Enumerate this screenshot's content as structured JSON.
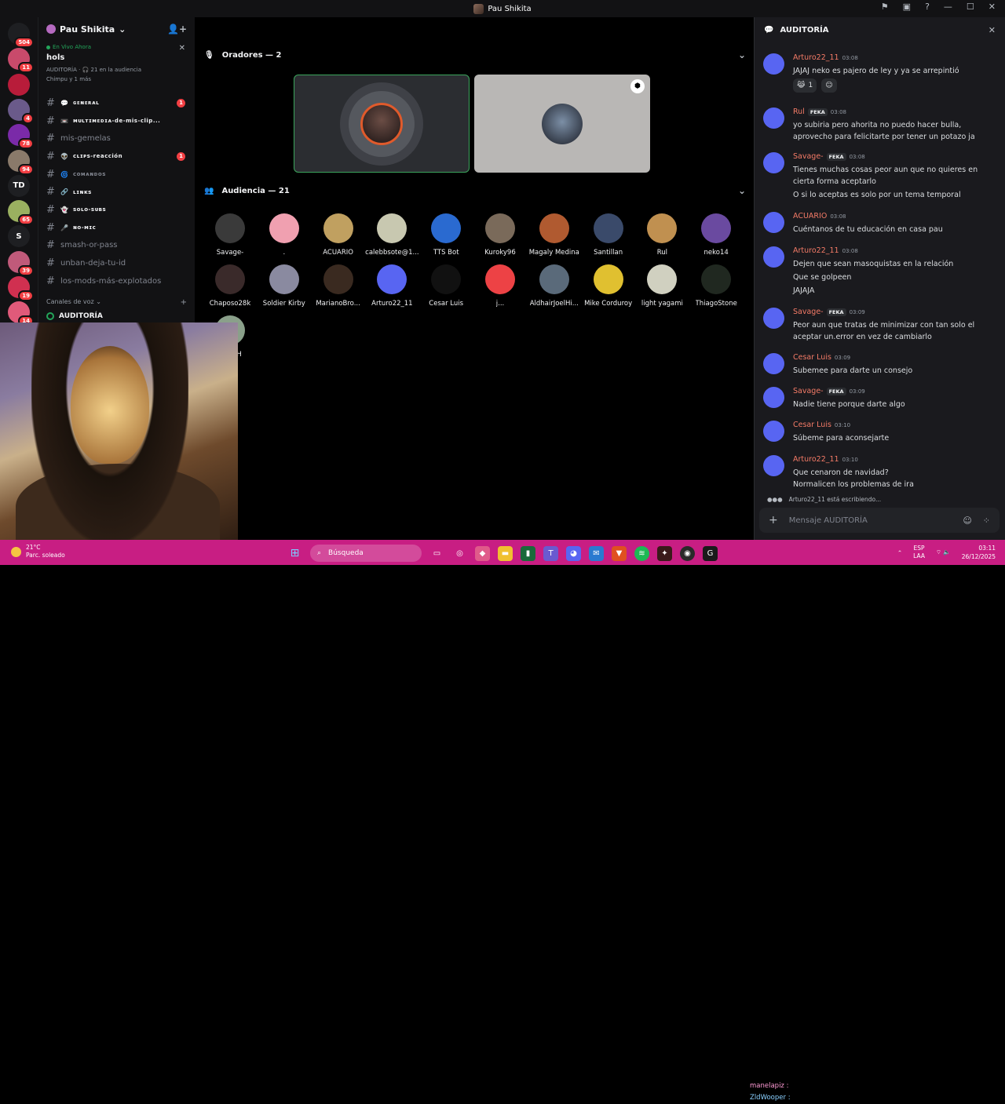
{
  "window": {
    "title": "Pau Shikita"
  },
  "rail": {
    "servers": [
      {
        "label": "",
        "badge": "504",
        "color": "#1e1f22"
      },
      {
        "label": "",
        "badge": "11",
        "color": "#c94a6b"
      },
      {
        "label": "",
        "badge": "",
        "color": "#b81c3a"
      },
      {
        "label": "",
        "badge": "4",
        "color": "#6a5a8a"
      },
      {
        "label": "",
        "badge": "78",
        "color": "#7a2aa8"
      },
      {
        "label": "",
        "badge": "94",
        "color": "#8a7a6a"
      },
      {
        "label": "TD",
        "badge": "",
        "color": "#1e1f22"
      },
      {
        "label": "",
        "badge": "65",
        "color": "#9ab060"
      },
      {
        "label": "S",
        "badge": "",
        "color": "#1e1f22"
      },
      {
        "label": "",
        "badge": "39",
        "color": "#c05a7a"
      },
      {
        "label": "",
        "badge": "19",
        "color": "#d03050"
      },
      {
        "label": "",
        "badge": "14",
        "color": "#e05a7a"
      }
    ]
  },
  "server": {
    "name": "Pau Shikita",
    "live_label": "En Vivo Ahora",
    "stage_title": "hols",
    "stage_meta": "AUDITORÍA · 🎧 21 en la audiencia",
    "stage_meta2": "Chimpu y 1 más",
    "channels": [
      {
        "name": "ɢᴇɴᴇʀᴀʟ",
        "emoji": "💬",
        "unread": true,
        "count": "1"
      },
      {
        "name": "ᴍᴜʟᴛɪᴍᴇᴅɪᴀ-de-mis-clip...",
        "emoji": "📼",
        "unread": true,
        "count": ""
      },
      {
        "name": "mis-gemelas",
        "emoji": "",
        "unread": false,
        "count": ""
      },
      {
        "name": "ᴄʟɪᴘꜱ-reacción",
        "emoji": "👽",
        "unread": true,
        "count": "1"
      },
      {
        "name": "ᴄᴏᴍᴀɴᴅᴏꜱ",
        "emoji": "🌀",
        "unread": false,
        "count": ""
      },
      {
        "name": "ʟɪɴᴋꜱ",
        "emoji": "🔗",
        "unread": true,
        "count": ""
      },
      {
        "name": "ꜱᴏʟᴏ-ꜱᴜʙꜱ",
        "emoji": "👻",
        "unread": true,
        "count": ""
      },
      {
        "name": "ɴᴏ-ᴍɪᴄ",
        "emoji": "🎤",
        "unread": true,
        "count": ""
      },
      {
        "name": "smash-or-pass",
        "emoji": "",
        "unread": false,
        "count": ""
      },
      {
        "name": "unban-deja-tu-id",
        "emoji": "",
        "unread": false,
        "count": ""
      },
      {
        "name": "los-mods-más-explotados",
        "emoji": "",
        "unread": false,
        "count": ""
      }
    ],
    "voice_category": "Canales de voz",
    "voice_channel": "AUDITORÍA"
  },
  "stage": {
    "speakers_label": "Oradores — 2",
    "audience_label": "Audiencia — 21",
    "audience": [
      {
        "name": "Savage-",
        "color": "#3a3a3a"
      },
      {
        "name": ".",
        "color": "#f0a0b0"
      },
      {
        "name": "ACUARIO",
        "color": "#c0a060"
      },
      {
        "name": "calebbsote@1...",
        "color": "#c8c8b0"
      },
      {
        "name": "TTS Bot",
        "color": "#2a6ad0"
      },
      {
        "name": "Kuroky96",
        "color": "#7a6a5a"
      },
      {
        "name": "Magaly Medina",
        "color": "#b05a30"
      },
      {
        "name": "Santillan",
        "color": "#3a4a6a"
      },
      {
        "name": "Rul",
        "color": "#c09050"
      },
      {
        "name": "neko14",
        "color": "#6a4aa0"
      },
      {
        "name": "Chaposo28k",
        "color": "#3a2a2a"
      },
      {
        "name": "Soldier Kirby",
        "color": "#8a8aa0"
      },
      {
        "name": "MarianoBro...",
        "color": "#3a2a20"
      },
      {
        "name": "Arturo22_11",
        "color": "#5865f2"
      },
      {
        "name": "Cesar Luis",
        "color": "#111111"
      },
      {
        "name": "j...",
        "color": "#ed4245"
      },
      {
        "name": "AldhairJoelHi...",
        "color": "#5a6a7a"
      },
      {
        "name": "Mike Corduroy",
        "color": "#e0c030"
      },
      {
        "name": "light yagami",
        "color": "#d0d0c0"
      },
      {
        "name": "ThiagoStone",
        "color": "#202820"
      },
      {
        "name": "...dezH",
        "color": "#8aa08a"
      }
    ]
  },
  "chat": {
    "title": "AUDITORÍA",
    "input_placeholder": "Mensaje AUDITORÍA",
    "typing": "Arturo22_11 está escribiendo...",
    "messages": [
      {
        "author": "Arturo22_11",
        "tag": "",
        "time": "03:08",
        "color": "#f47b67",
        "lines": [
          "JAJAJ neko es pajero de ley y ya se arrepintió"
        ]
      },
      {
        "author": "Rul",
        "tag": "FEKA",
        "time": "03:08",
        "color": "#f47b67",
        "lines": [
          "yo subiria pero ahorita no puedo hacer bulla,",
          "aprovecho para felicitarte por tener un potazo ja"
        ]
      },
      {
        "author": "Savage-",
        "tag": "FEKA",
        "time": "03:08",
        "color": "#f47b67",
        "lines": [
          "Tienes muchas cosas peor aun que no quieres en",
          "cierta forma aceptarlo",
          "O si lo aceptas es solo por un tema temporal"
        ]
      },
      {
        "author": "ACUARIO",
        "tag": "",
        "time": "03:08",
        "color": "#f47b67",
        "lines": [
          "Cuéntanos de tu educación en casa pau"
        ]
      },
      {
        "author": "Arturo22_11",
        "tag": "",
        "time": "03:08",
        "color": "#f47b67",
        "lines": [
          "Dejen que sean masoquistas en la relación",
          "Que se golpeen",
          "JAJAJA"
        ]
      },
      {
        "author": "Savage-",
        "tag": "FEKA",
        "time": "03:09",
        "color": "#f47b67",
        "lines": [
          "Peor aun que tratas de minimizar con tan solo el",
          "aceptar un.error en vez de cambiarlo"
        ]
      },
      {
        "author": "Cesar Luis",
        "tag": "",
        "time": "03:09",
        "color": "#f47b67",
        "lines": [
          "Subemee para darte un consejo"
        ]
      },
      {
        "author": "Savage-",
        "tag": "FEKA",
        "time": "03:09",
        "color": "#f47b67",
        "lines": [
          "Nadie tiene porque darte algo"
        ]
      },
      {
        "author": "Cesar Luis",
        "tag": "",
        "time": "03:10",
        "color": "#f47b67",
        "lines": [
          "Súbeme  para aconsejarte"
        ]
      },
      {
        "author": "Arturo22_11",
        "tag": "",
        "time": "03:10",
        "color": "#f47b67",
        "lines": [
          "Que cenaron de navidad?",
          "Normalicen los problemas de ira"
        ]
      }
    ],
    "reaction_count": "1"
  },
  "taskbar": {
    "temp": "21°C",
    "weather": "Parc. soleado",
    "search": "Búsqueda",
    "ticker1": "manelapiz :",
    "ticker2": "ZldWooper :",
    "lang1": "ESP",
    "lang2": "LAA",
    "time": "03:11",
    "date": "26/12/2025"
  }
}
